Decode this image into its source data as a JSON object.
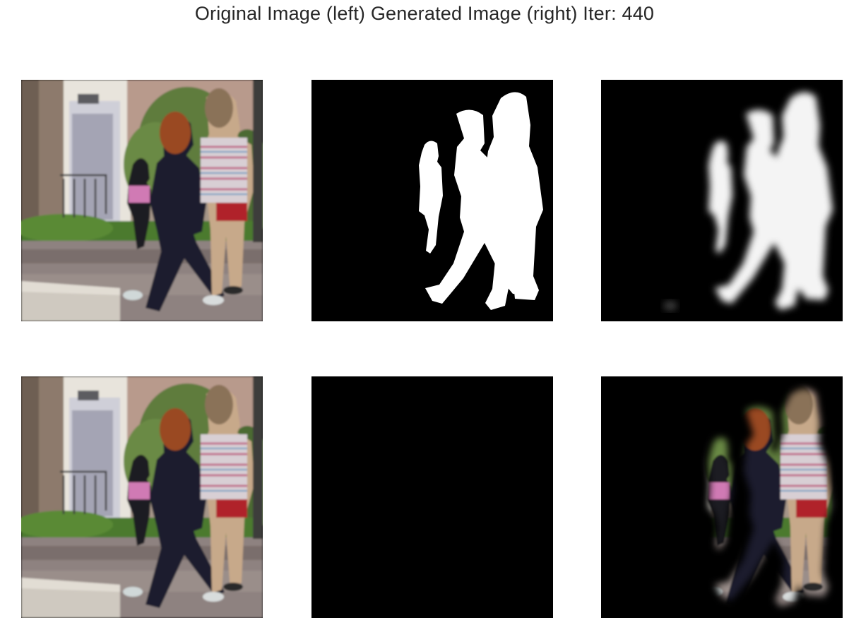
{
  "figure": {
    "title": "Original Image (left) Generated Image (right) Iter: 440"
  },
  "panels": [
    {
      "id": "orig-top",
      "content": "original street photo of children walking"
    },
    {
      "id": "mask-top",
      "content": "ground-truth binary mask"
    },
    {
      "id": "gen-top",
      "content": "generated soft mask"
    },
    {
      "id": "orig-bot",
      "content": "original street photo of children walking"
    },
    {
      "id": "mask-bot",
      "content": "ground-truth masked photo"
    },
    {
      "id": "gen-bot",
      "content": "generated masked photo"
    }
  ],
  "colors": {
    "background": "#ffffff",
    "title_text": "#262626",
    "mask_fg": "#ffffff",
    "mask_bg": "#000000"
  }
}
